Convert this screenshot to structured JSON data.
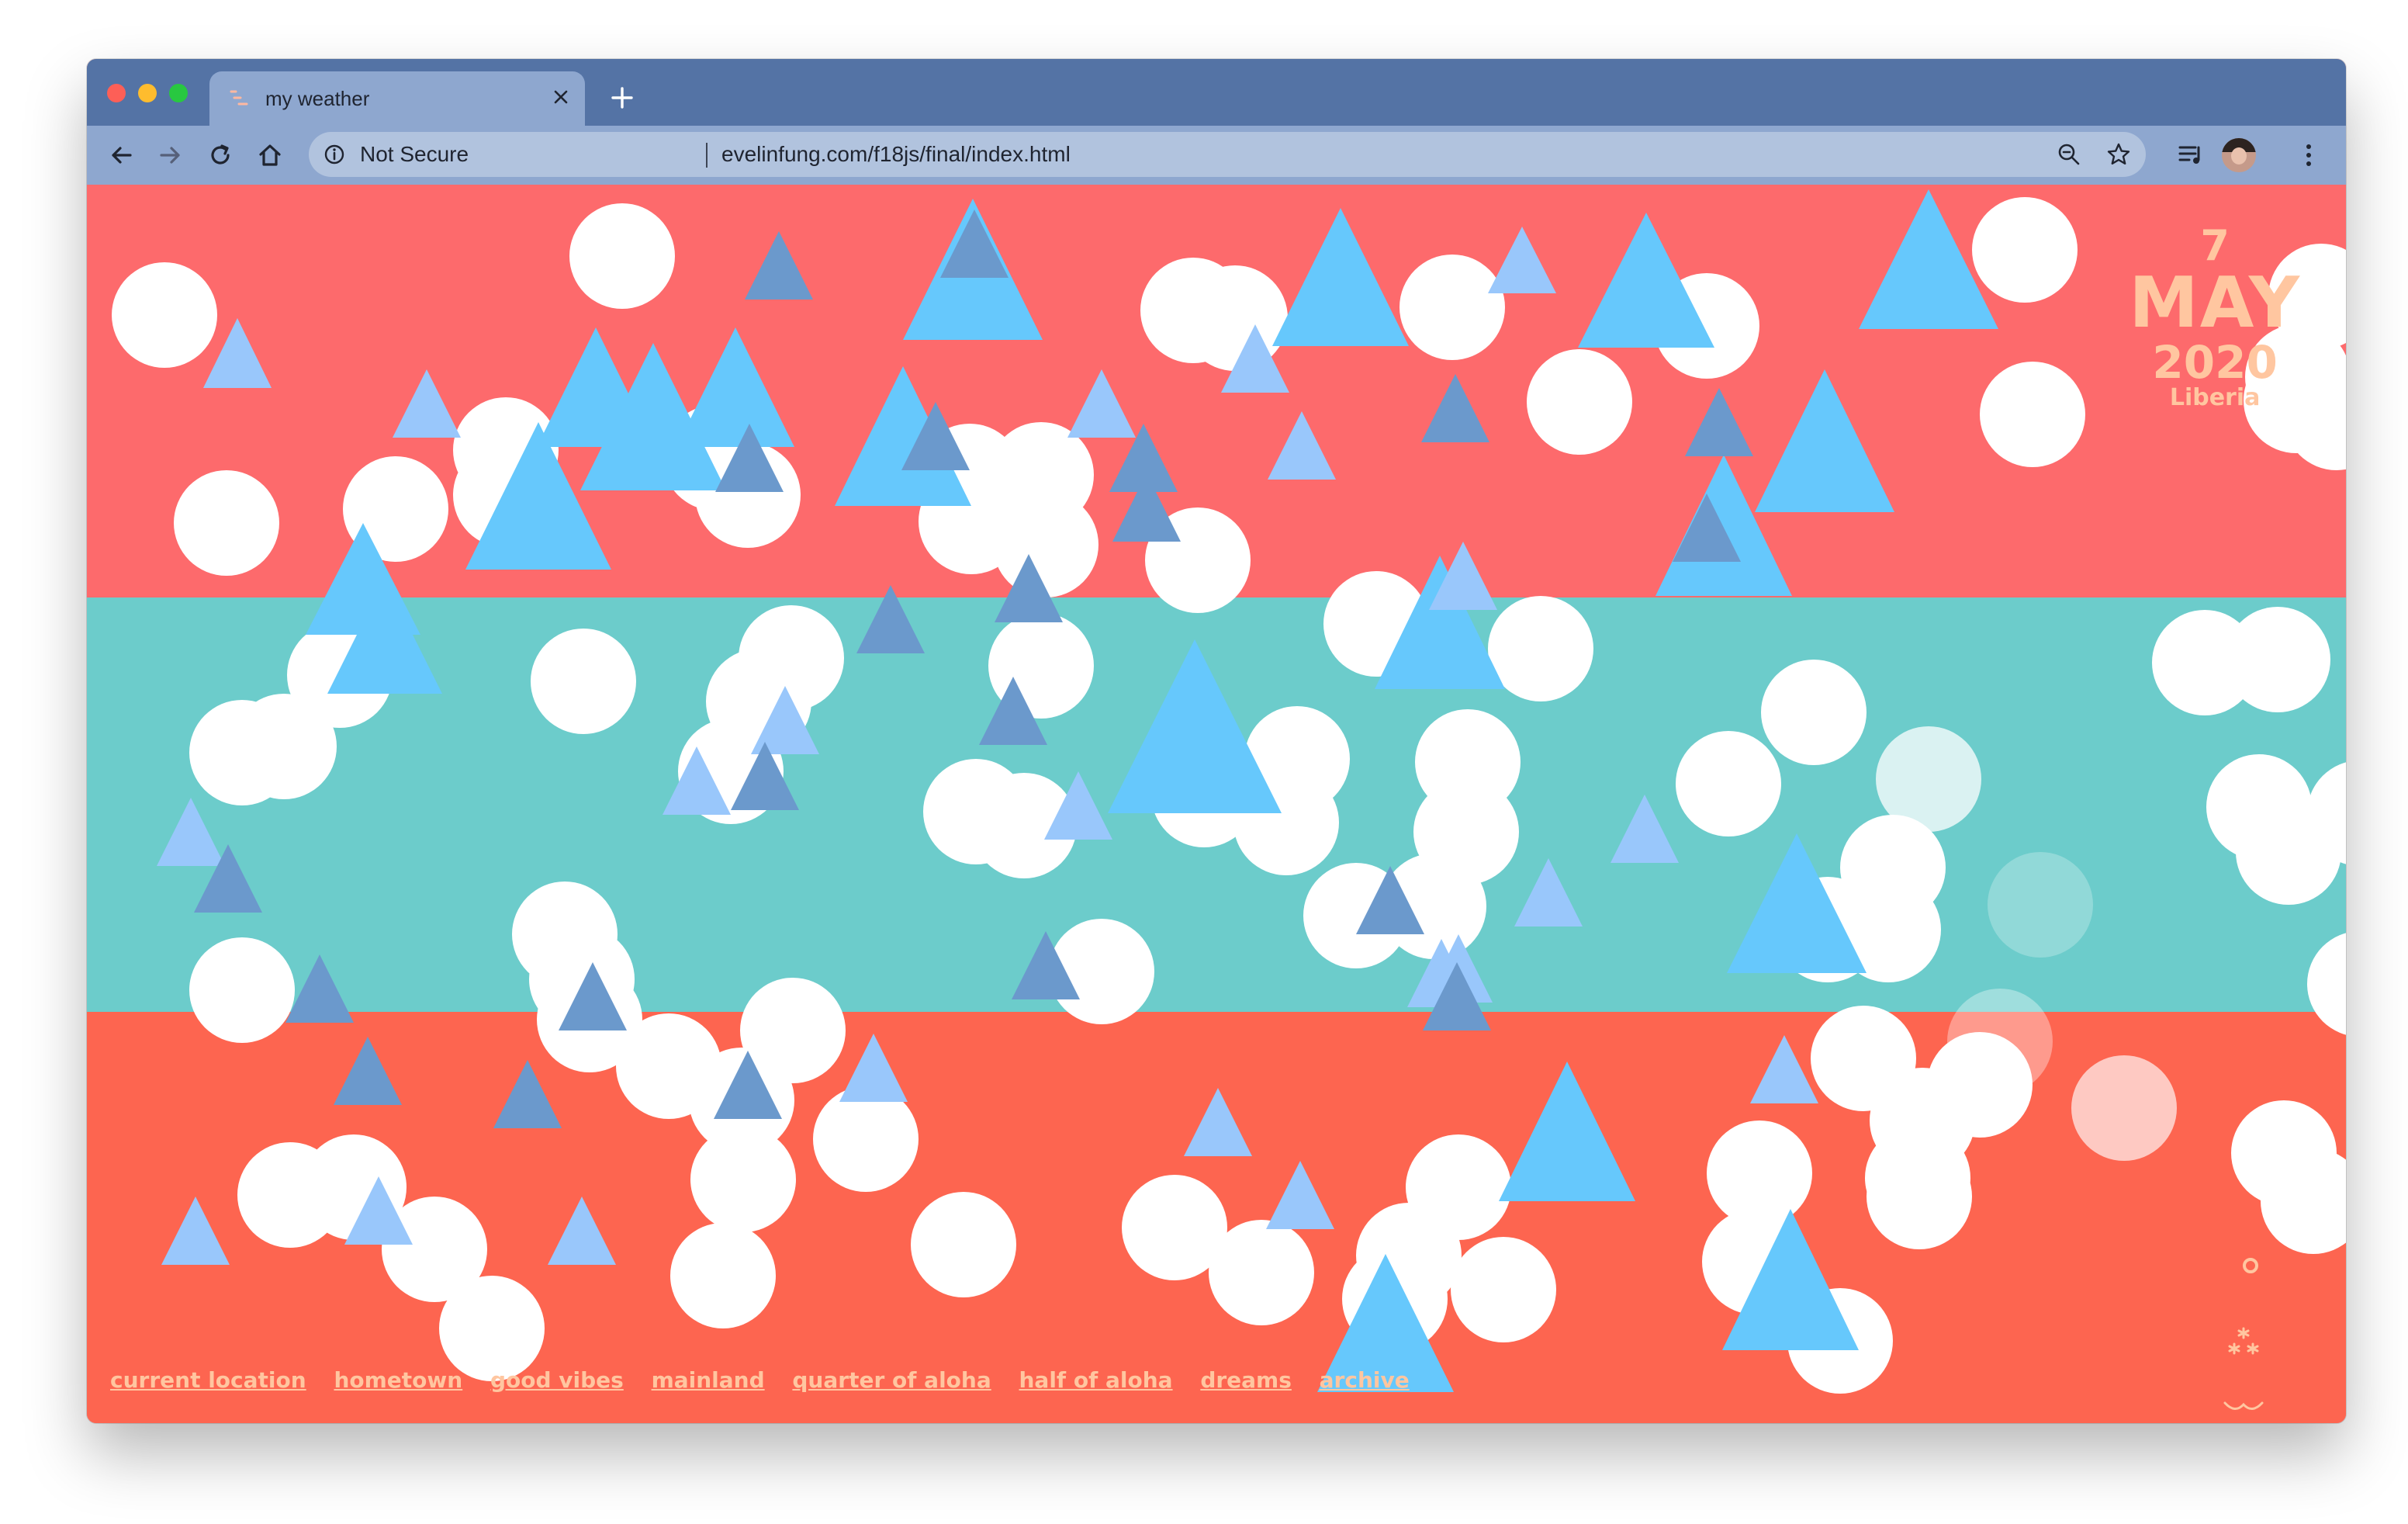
{
  "browser": {
    "tab_title": "my weather",
    "security_label": "Not Secure",
    "url": "evelinfung.com/f18js/final/index.html"
  },
  "weather": {
    "day": "7",
    "month": "MAY",
    "year": "2020",
    "location": "Liberia"
  },
  "nav": {
    "links": [
      "current location",
      "hometown",
      "good vibes",
      "mainland",
      "quarter of aloha",
      "half of aloha",
      "dreams",
      "archive"
    ]
  },
  "side_icons": [
    "sun-icon",
    "snowflake-icon",
    "wave-icon"
  ],
  "colors": {
    "top_band": "#fd6a6c",
    "middle_band": "#6ccccb",
    "bottom_band": "#fd6550",
    "circle": "#ffffff",
    "triangle_bright": "#66c8fc",
    "triangle_light": "#99c7fb",
    "triangle_dark": "#6b99cc",
    "accent_text": "#ffc6a0"
  }
}
